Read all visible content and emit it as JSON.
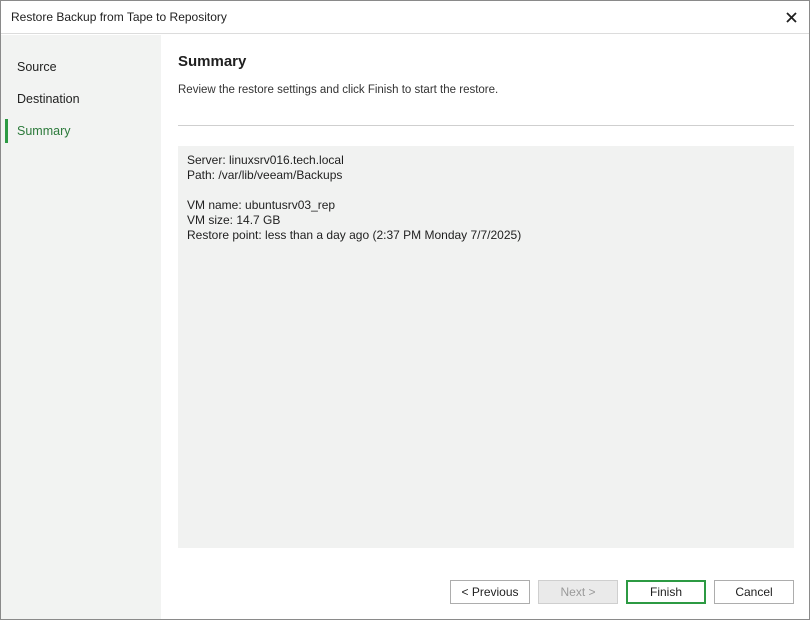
{
  "window": {
    "title": "Restore Backup from Tape to Repository",
    "close_glyph": "✕"
  },
  "sidebar": {
    "items": [
      {
        "label": "Source",
        "active": false
      },
      {
        "label": "Destination",
        "active": false
      },
      {
        "label": "Summary",
        "active": true
      }
    ]
  },
  "main": {
    "title": "Summary",
    "subtitle": "Review the restore settings and click Finish to start the restore.",
    "summary": {
      "server": "Server: linuxsrv016.tech.local",
      "path": "Path: /var/lib/veeam/Backups",
      "vm_name": "VM name: ubuntusrv03_rep",
      "vm_size": "VM size: 14.7 GB",
      "restore_point": "Restore point: less than a day ago (2:37 PM Monday 7/7/2025)"
    }
  },
  "buttons": {
    "previous": "< Previous",
    "next": "Next >",
    "finish": "Finish",
    "cancel": "Cancel"
  },
  "colors": {
    "accent": "#2c9a43",
    "active_nav_text": "#2c7a3b",
    "sidebar_bg": "#f2f3f2",
    "summary_bg": "#f1f2f1"
  }
}
